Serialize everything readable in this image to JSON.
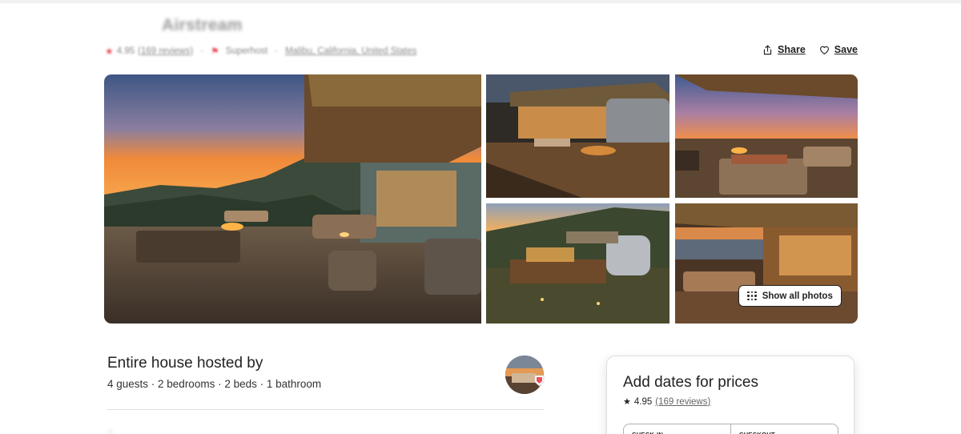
{
  "listing": {
    "title": "Airstream",
    "rating": "4.95",
    "reviews_link": "(169 reviews)",
    "superhost_label": "Superhost",
    "location": "Malibu, California, United States"
  },
  "actions": {
    "share_label": "Share",
    "save_label": "Save"
  },
  "gallery": {
    "show_all_label": "Show all photos",
    "photo_count": 5
  },
  "host": {
    "title": "Entire house hosted by",
    "details": "4 guests · 2 bedrooms · 2 beds · 1 bathroom"
  },
  "booking": {
    "title": "Add dates for prices",
    "rating": "4.95",
    "reviews_link": "(169 reviews)",
    "checkin_label": "CHECK-IN",
    "checkout_label": "CHECKOUT"
  },
  "icons": {
    "share": "share-icon",
    "save": "heart-icon",
    "grid": "grid-dots-icon",
    "star": "star-icon"
  },
  "colors": {
    "brand": "#E8505B",
    "text": "#222222",
    "muted": "#717171"
  }
}
